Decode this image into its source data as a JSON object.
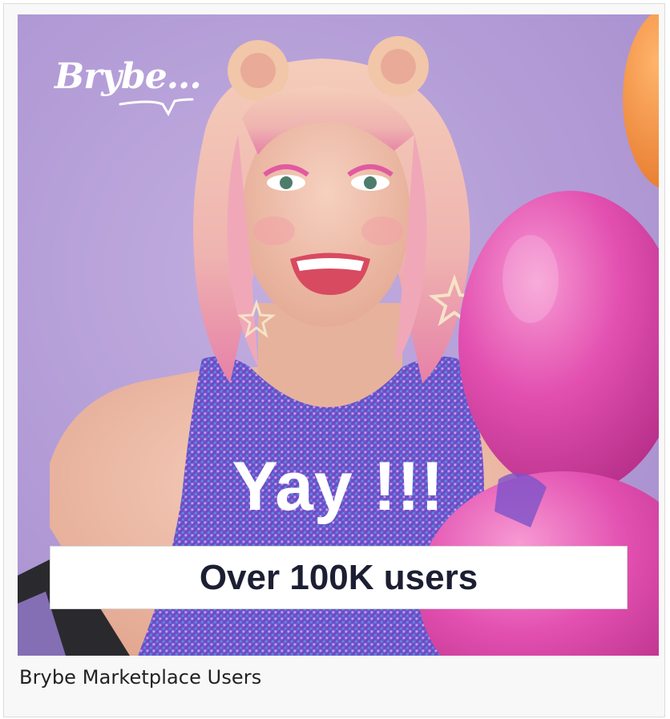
{
  "logo": {
    "text": "Brybe..."
  },
  "headline": "Yay !!!",
  "banner": {
    "text": "Over 100K users"
  },
  "caption": "Brybe Marketplace Users",
  "colors": {
    "background": "#b7a0d6",
    "balloon_pink": "#e24fb0",
    "balloon_orange": "#f08a3c",
    "sequin_purple": "#7c4fc9",
    "hair": "#f0c8b8",
    "banner_text": "#1c1f33"
  }
}
